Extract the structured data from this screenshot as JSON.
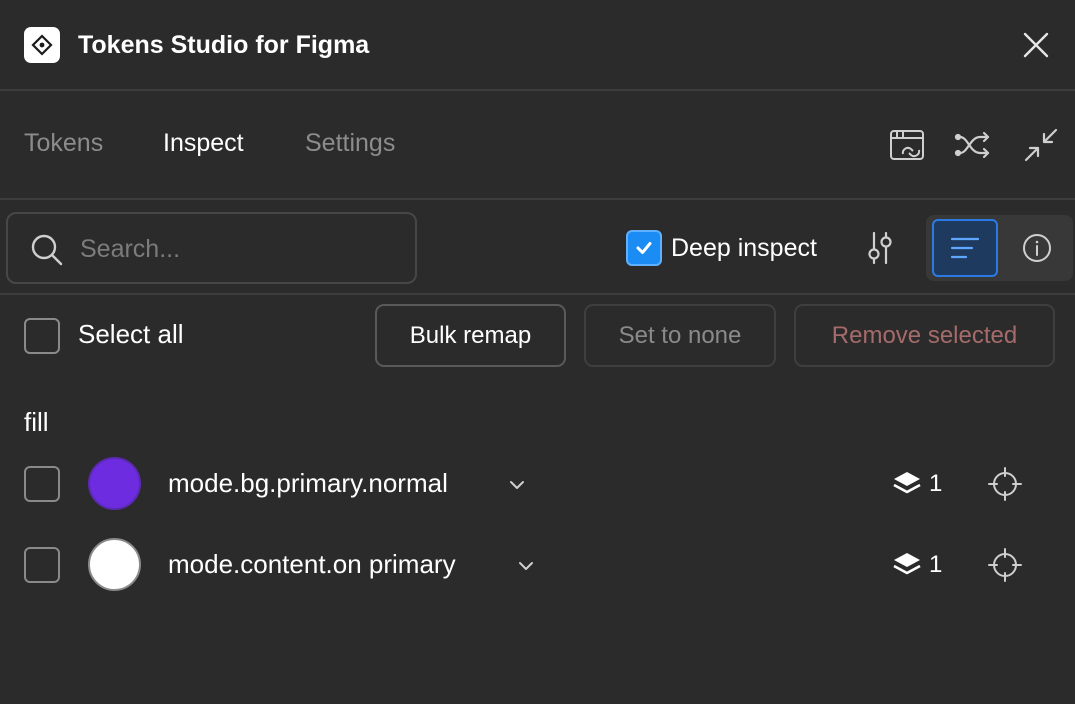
{
  "app": {
    "title": "Tokens Studio for Figma"
  },
  "tabs": [
    {
      "label": "Tokens",
      "active": false
    },
    {
      "label": "Inspect",
      "active": true
    },
    {
      "label": "Settings",
      "active": false
    }
  ],
  "toolbar_icons": [
    "sync-icon",
    "shuffle-icon",
    "collapse-icon"
  ],
  "search": {
    "placeholder": "Search...",
    "value": ""
  },
  "deep_inspect": {
    "label": "Deep inspect",
    "checked": true
  },
  "select_all": {
    "label": "Select all",
    "checked": false
  },
  "actions": {
    "bulk_remap": "Bulk remap",
    "set_to_none": "Set to none",
    "remove_selected": "Remove selected"
  },
  "groups": [
    {
      "name": "fill",
      "tokens": [
        {
          "name": "mode.bg.primary.normal",
          "color": "#6d2ce0",
          "count": "1",
          "checked": false
        },
        {
          "name": "mode.content.on primary",
          "color": "#ffffff",
          "count": "1",
          "checked": false
        }
      ]
    }
  ],
  "colors": {
    "background": "#2b2b2b",
    "accent": "#1a8cf4",
    "danger_text": "#a56b6b"
  }
}
